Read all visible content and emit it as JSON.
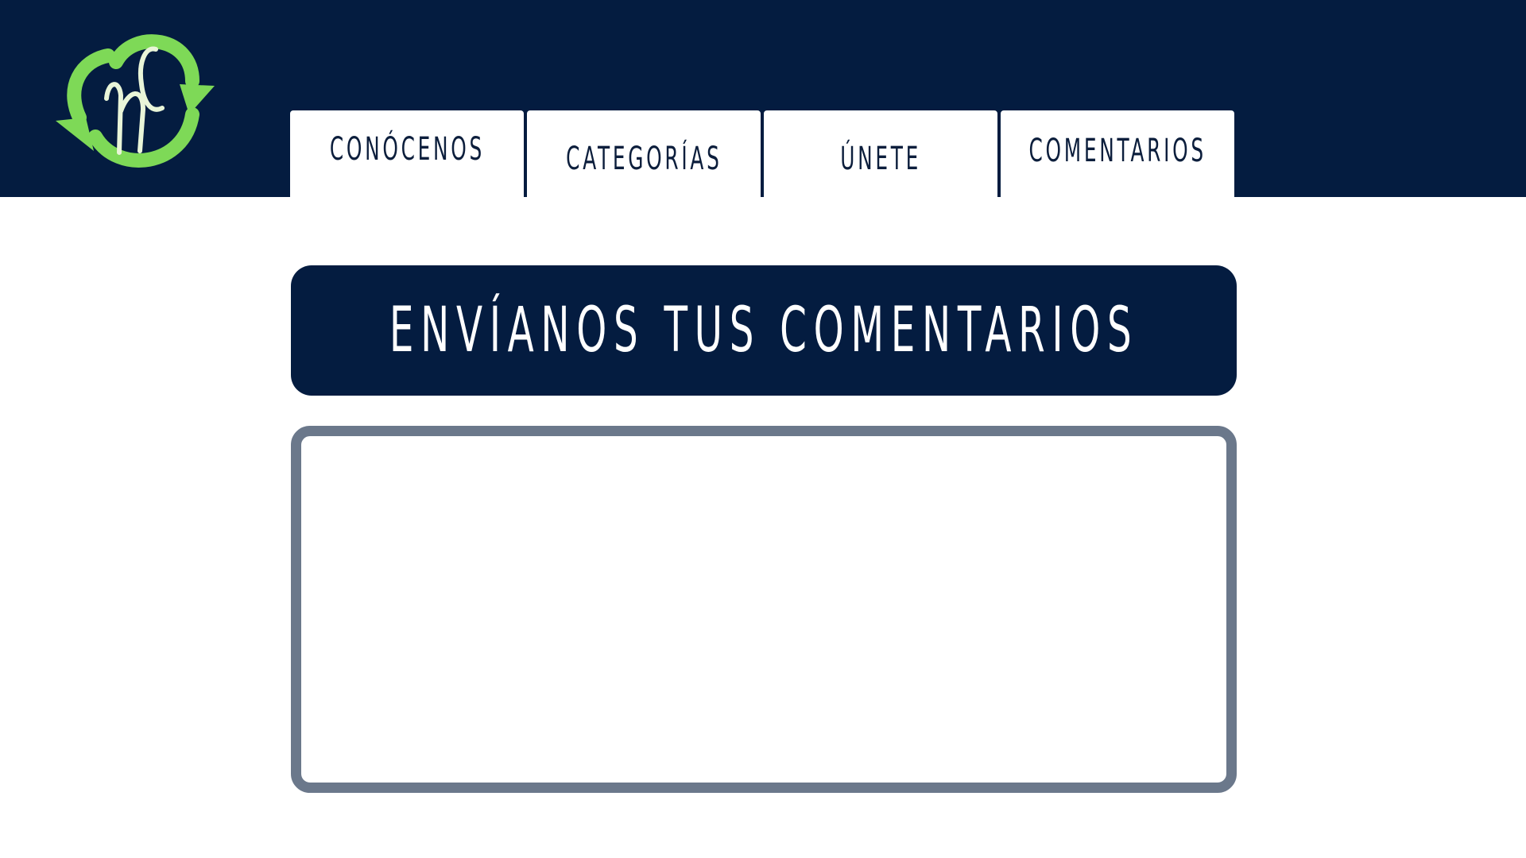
{
  "colors": {
    "navy": "#041c40",
    "tab_text": "#0c1e3c",
    "logo_green": "#7ed957",
    "logo_cream": "#e9f5d8",
    "box_border": "#6b788b",
    "white": "#ffffff"
  },
  "logo": {
    "icon": "recycle-arrows-nc-logo-icon",
    "letters": "nc"
  },
  "nav": {
    "tabs": [
      {
        "label": "CONÓCENOS"
      },
      {
        "label": "CATEGORÍAS"
      },
      {
        "label": "ÚNETE"
      },
      {
        "label": "COMENTARIOS"
      }
    ]
  },
  "main": {
    "title": "ENVÍANOS TUS COMENTARIOS",
    "comment_value": ""
  }
}
